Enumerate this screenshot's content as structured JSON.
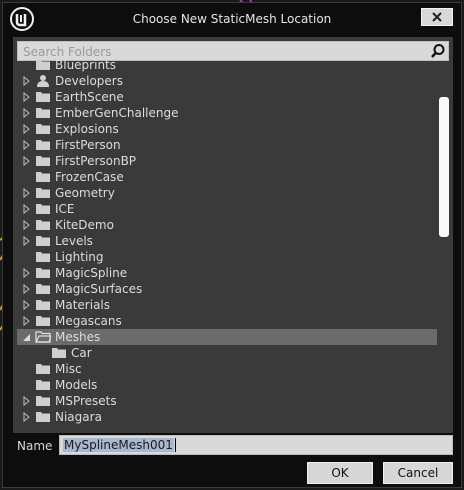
{
  "window": {
    "title": "Choose New StaticMesh Location",
    "close_icon": "close-icon"
  },
  "search": {
    "placeholder": "Search Folders",
    "icon": "search-icon"
  },
  "tree": {
    "items": [
      {
        "label": "Blueprints",
        "expandable": false,
        "icon": "folder-icon",
        "partial": true
      },
      {
        "label": "Developers",
        "expandable": true,
        "icon": "user-icon"
      },
      {
        "label": "EarthScene",
        "expandable": true,
        "icon": "folder-icon"
      },
      {
        "label": "EmberGenChallenge",
        "expandable": true,
        "icon": "folder-icon"
      },
      {
        "label": "Explosions",
        "expandable": true,
        "icon": "folder-icon"
      },
      {
        "label": "FirstPerson",
        "expandable": true,
        "icon": "folder-icon"
      },
      {
        "label": "FirstPersonBP",
        "expandable": true,
        "icon": "folder-icon"
      },
      {
        "label": "FrozenCase",
        "expandable": false,
        "icon": "folder-icon"
      },
      {
        "label": "Geometry",
        "expandable": true,
        "icon": "folder-icon"
      },
      {
        "label": "ICE",
        "expandable": true,
        "icon": "folder-icon"
      },
      {
        "label": "KiteDemo",
        "expandable": true,
        "icon": "folder-icon"
      },
      {
        "label": "Levels",
        "expandable": true,
        "icon": "folder-icon"
      },
      {
        "label": "Lighting",
        "expandable": false,
        "icon": "folder-icon"
      },
      {
        "label": "MagicSpline",
        "expandable": true,
        "icon": "folder-icon"
      },
      {
        "label": "MagicSurfaces",
        "expandable": true,
        "icon": "folder-icon"
      },
      {
        "label": "Materials",
        "expandable": true,
        "icon": "folder-icon"
      },
      {
        "label": "Megascans",
        "expandable": true,
        "icon": "folder-icon"
      },
      {
        "label": "Meshes",
        "expandable": true,
        "expanded": true,
        "selected": true,
        "icon": "folder-open-icon"
      },
      {
        "label": "Car",
        "expandable": false,
        "icon": "folder-icon",
        "child": true
      },
      {
        "label": "Misc",
        "expandable": false,
        "icon": "folder-icon"
      },
      {
        "label": "Models",
        "expandable": false,
        "icon": "folder-icon"
      },
      {
        "label": "MSPresets",
        "expandable": true,
        "icon": "folder-icon"
      },
      {
        "label": "Niagara",
        "expandable": true,
        "icon": "folder-icon"
      }
    ]
  },
  "footer": {
    "name_label": "Name",
    "name_value": "MySplineMesh001",
    "ok_label": "OK",
    "cancel_label": "Cancel"
  }
}
